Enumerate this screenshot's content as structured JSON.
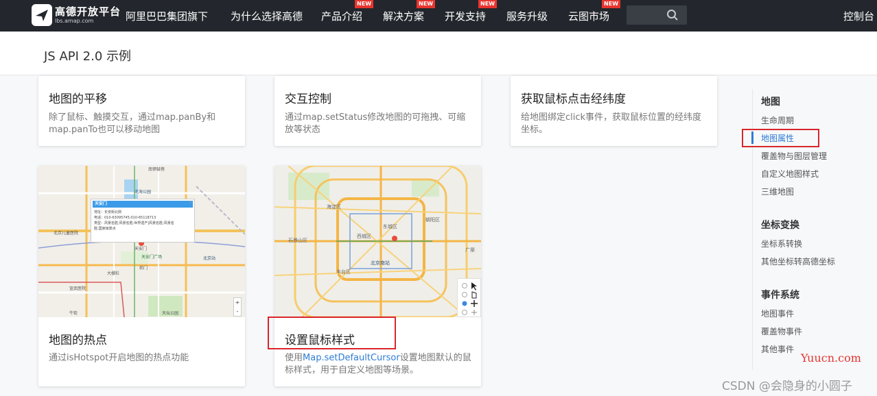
{
  "nav": {
    "logo_title": "高德开放平台",
    "logo_sub": "lbs.amap.com",
    "items": [
      {
        "label": "阿里巴巴集团旗下",
        "badge": ""
      },
      {
        "label": "为什么选择高德",
        "badge": ""
      },
      {
        "label": "产品介绍",
        "badge": "NEW"
      },
      {
        "label": "解决方案",
        "badge": "NEW"
      },
      {
        "label": "开发支持",
        "badge": "NEW"
      },
      {
        "label": "服务升级",
        "badge": ""
      },
      {
        "label": "云图市场",
        "badge": "NEW"
      }
    ],
    "console": "控制台",
    "search_icon": "search-icon"
  },
  "page_title": "JS API 2.0 示例",
  "cards": [
    {
      "title": "地图的平移",
      "desc": "除了鼠标、触摸交互，通过map.panBy和map.panTo也可以移动地图"
    },
    {
      "title": "交互控制",
      "desc": "通过map.setStatus修改地图的可拖拽、可缩放等状态"
    },
    {
      "title": "获取鼠标点击经纬度",
      "desc": "给地图绑定click事件，获取鼠标位置的经纬度坐标。"
    },
    {
      "title": "地图的热点",
      "desc": "通过isHotspot开启地图的热点功能"
    },
    {
      "title": "设置鼠标样式",
      "desc_prefix": "使用",
      "desc_code": "Map.setDefaultCursor",
      "desc_suffix": "设置地图默认的鼠标样式，用于自定义地图等场景。"
    }
  ],
  "hotspot_map": {
    "popup_title": "天安门",
    "popup_lines": [
      "地址：长安街北侧",
      "电话：010-63095745;010-65118713",
      "类型：风景名胜;风景名胜;世界遗产|风景名胜;风景名",
      "胜;国家级景点"
    ],
    "labels": [
      "北海公园",
      "北京儿童医院",
      "天安门广场",
      "天安门",
      "北京站",
      "宣武医院",
      "牛街",
      "天坛公园",
      "大栅栏",
      "前门",
      "南锣鼓巷"
    ],
    "zoom_in": "+",
    "zoom_out": "-"
  },
  "cursor_map": {
    "labels": [
      "海淀区",
      "西城区",
      "东城区",
      "石景山区",
      "北京南站",
      "丰台区",
      "朝阳区",
      "广渠"
    ]
  },
  "sidebar": {
    "sections": [
      {
        "heading": "地图",
        "items": [
          "生命周期",
          "地图属性",
          "覆盖物与图层管理",
          "自定义地图样式",
          "三维地图"
        ]
      },
      {
        "heading": "坐标变换",
        "items": [
          "坐标系转换",
          "其他坐标转高德坐标"
        ]
      },
      {
        "heading": "事件系统",
        "items": [
          "地图事件",
          "覆盖物事件",
          "其他事件"
        ]
      }
    ],
    "active_item": "地图属性"
  },
  "watermarks": {
    "yuucn": "Yuucn.com",
    "csdn": "CSDN @会隐身的小圆子"
  },
  "colors": {
    "nav_bg": "#23272d",
    "accent": "#2e7bd6",
    "badge": "#e8342e",
    "highlight_box": "#d9252b"
  }
}
